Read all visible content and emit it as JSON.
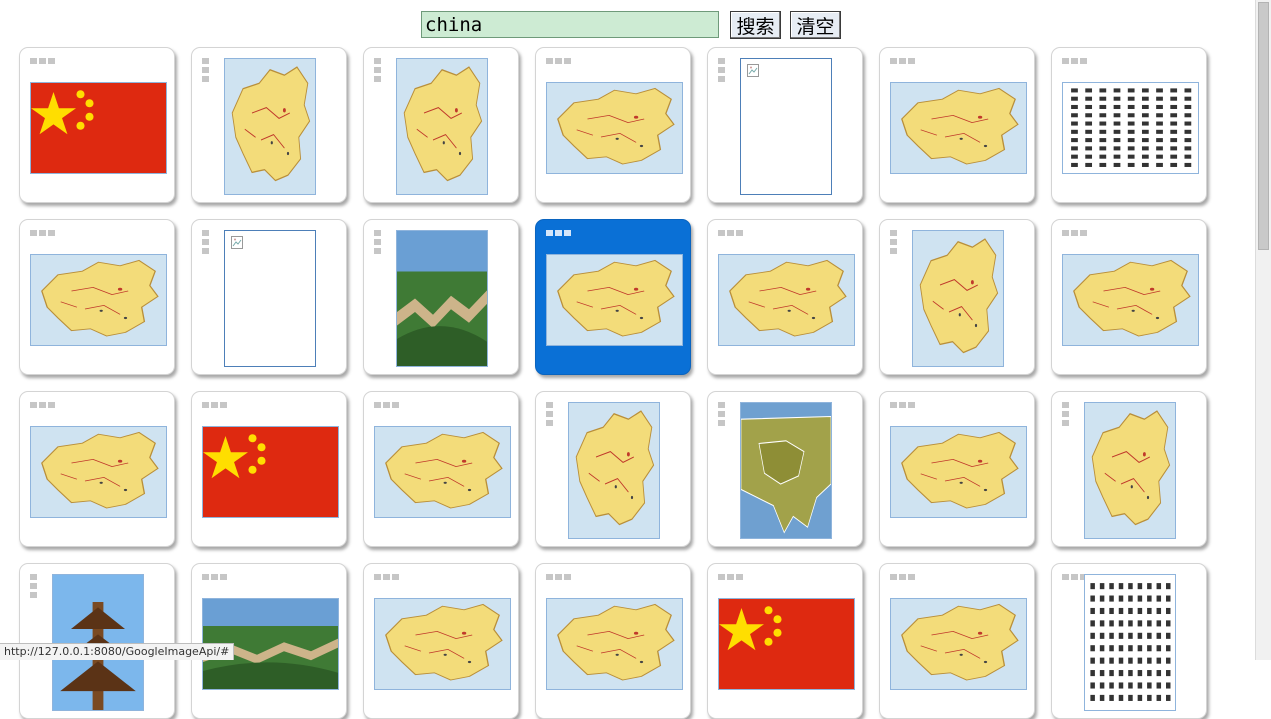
{
  "search": {
    "query": "china",
    "search_label": "搜索",
    "clear_label": "清空"
  },
  "status_bar": {
    "url": "http://127.0.0.1:8080/GoogleImageApi/#"
  },
  "selected_index": 10,
  "results": [
    {
      "icon": "china-flag-icon",
      "orientation": "landscape",
      "grip": "h"
    },
    {
      "icon": "china-map-icon",
      "orientation": "portrait",
      "grip": "v"
    },
    {
      "icon": "china-map-icon",
      "orientation": "portrait",
      "grip": "v"
    },
    {
      "icon": "china-map-icon",
      "orientation": "landscape",
      "grip": "h"
    },
    {
      "icon": "broken-image-icon",
      "orientation": "portrait",
      "grip": "v"
    },
    {
      "icon": "china-map-icon",
      "orientation": "landscape",
      "grip": "h"
    },
    {
      "icon": "chinese-characters-icon",
      "orientation": "landscape",
      "grip": "h"
    },
    {
      "icon": "china-map-icon",
      "orientation": "landscape",
      "grip": "h"
    },
    {
      "icon": "broken-image-icon",
      "orientation": "portrait",
      "grip": "v"
    },
    {
      "icon": "great-wall-icon",
      "orientation": "portrait",
      "grip": "v"
    },
    {
      "icon": "china-map-icon",
      "orientation": "landscape",
      "grip": "h"
    },
    {
      "icon": "china-map-icon",
      "orientation": "landscape",
      "grip": "h"
    },
    {
      "icon": "china-map-icon",
      "orientation": "portrait",
      "grip": "v"
    },
    {
      "icon": "china-map-icon",
      "orientation": "landscape",
      "grip": "h"
    },
    {
      "icon": "china-map-icon",
      "orientation": "landscape",
      "grip": "h"
    },
    {
      "icon": "china-flag-icon",
      "orientation": "landscape",
      "grip": "h"
    },
    {
      "icon": "china-map-icon",
      "orientation": "landscape",
      "grip": "h"
    },
    {
      "icon": "china-map-icon",
      "orientation": "portrait",
      "grip": "v"
    },
    {
      "icon": "asia-map-icon",
      "orientation": "portrait",
      "grip": "v"
    },
    {
      "icon": "china-map-icon",
      "orientation": "landscape",
      "grip": "h"
    },
    {
      "icon": "china-map-icon",
      "orientation": "portrait",
      "grip": "v"
    },
    {
      "icon": "pagoda-icon",
      "orientation": "portrait",
      "grip": "v"
    },
    {
      "icon": "great-wall-icon",
      "orientation": "landscape",
      "grip": "h"
    },
    {
      "icon": "china-map-icon",
      "orientation": "landscape",
      "grip": "h"
    },
    {
      "icon": "china-map-icon",
      "orientation": "landscape",
      "grip": "h"
    },
    {
      "icon": "china-flag-icon",
      "orientation": "landscape",
      "grip": "h"
    },
    {
      "icon": "china-map-icon",
      "orientation": "landscape",
      "grip": "h"
    },
    {
      "icon": "chinese-characters-icon",
      "orientation": "portrait",
      "grip": "h"
    }
  ],
  "colors": {
    "selected_card": "#0a70d6",
    "search_input_bg": "#cdebd3",
    "thumb_border": "#8fb4dc"
  }
}
